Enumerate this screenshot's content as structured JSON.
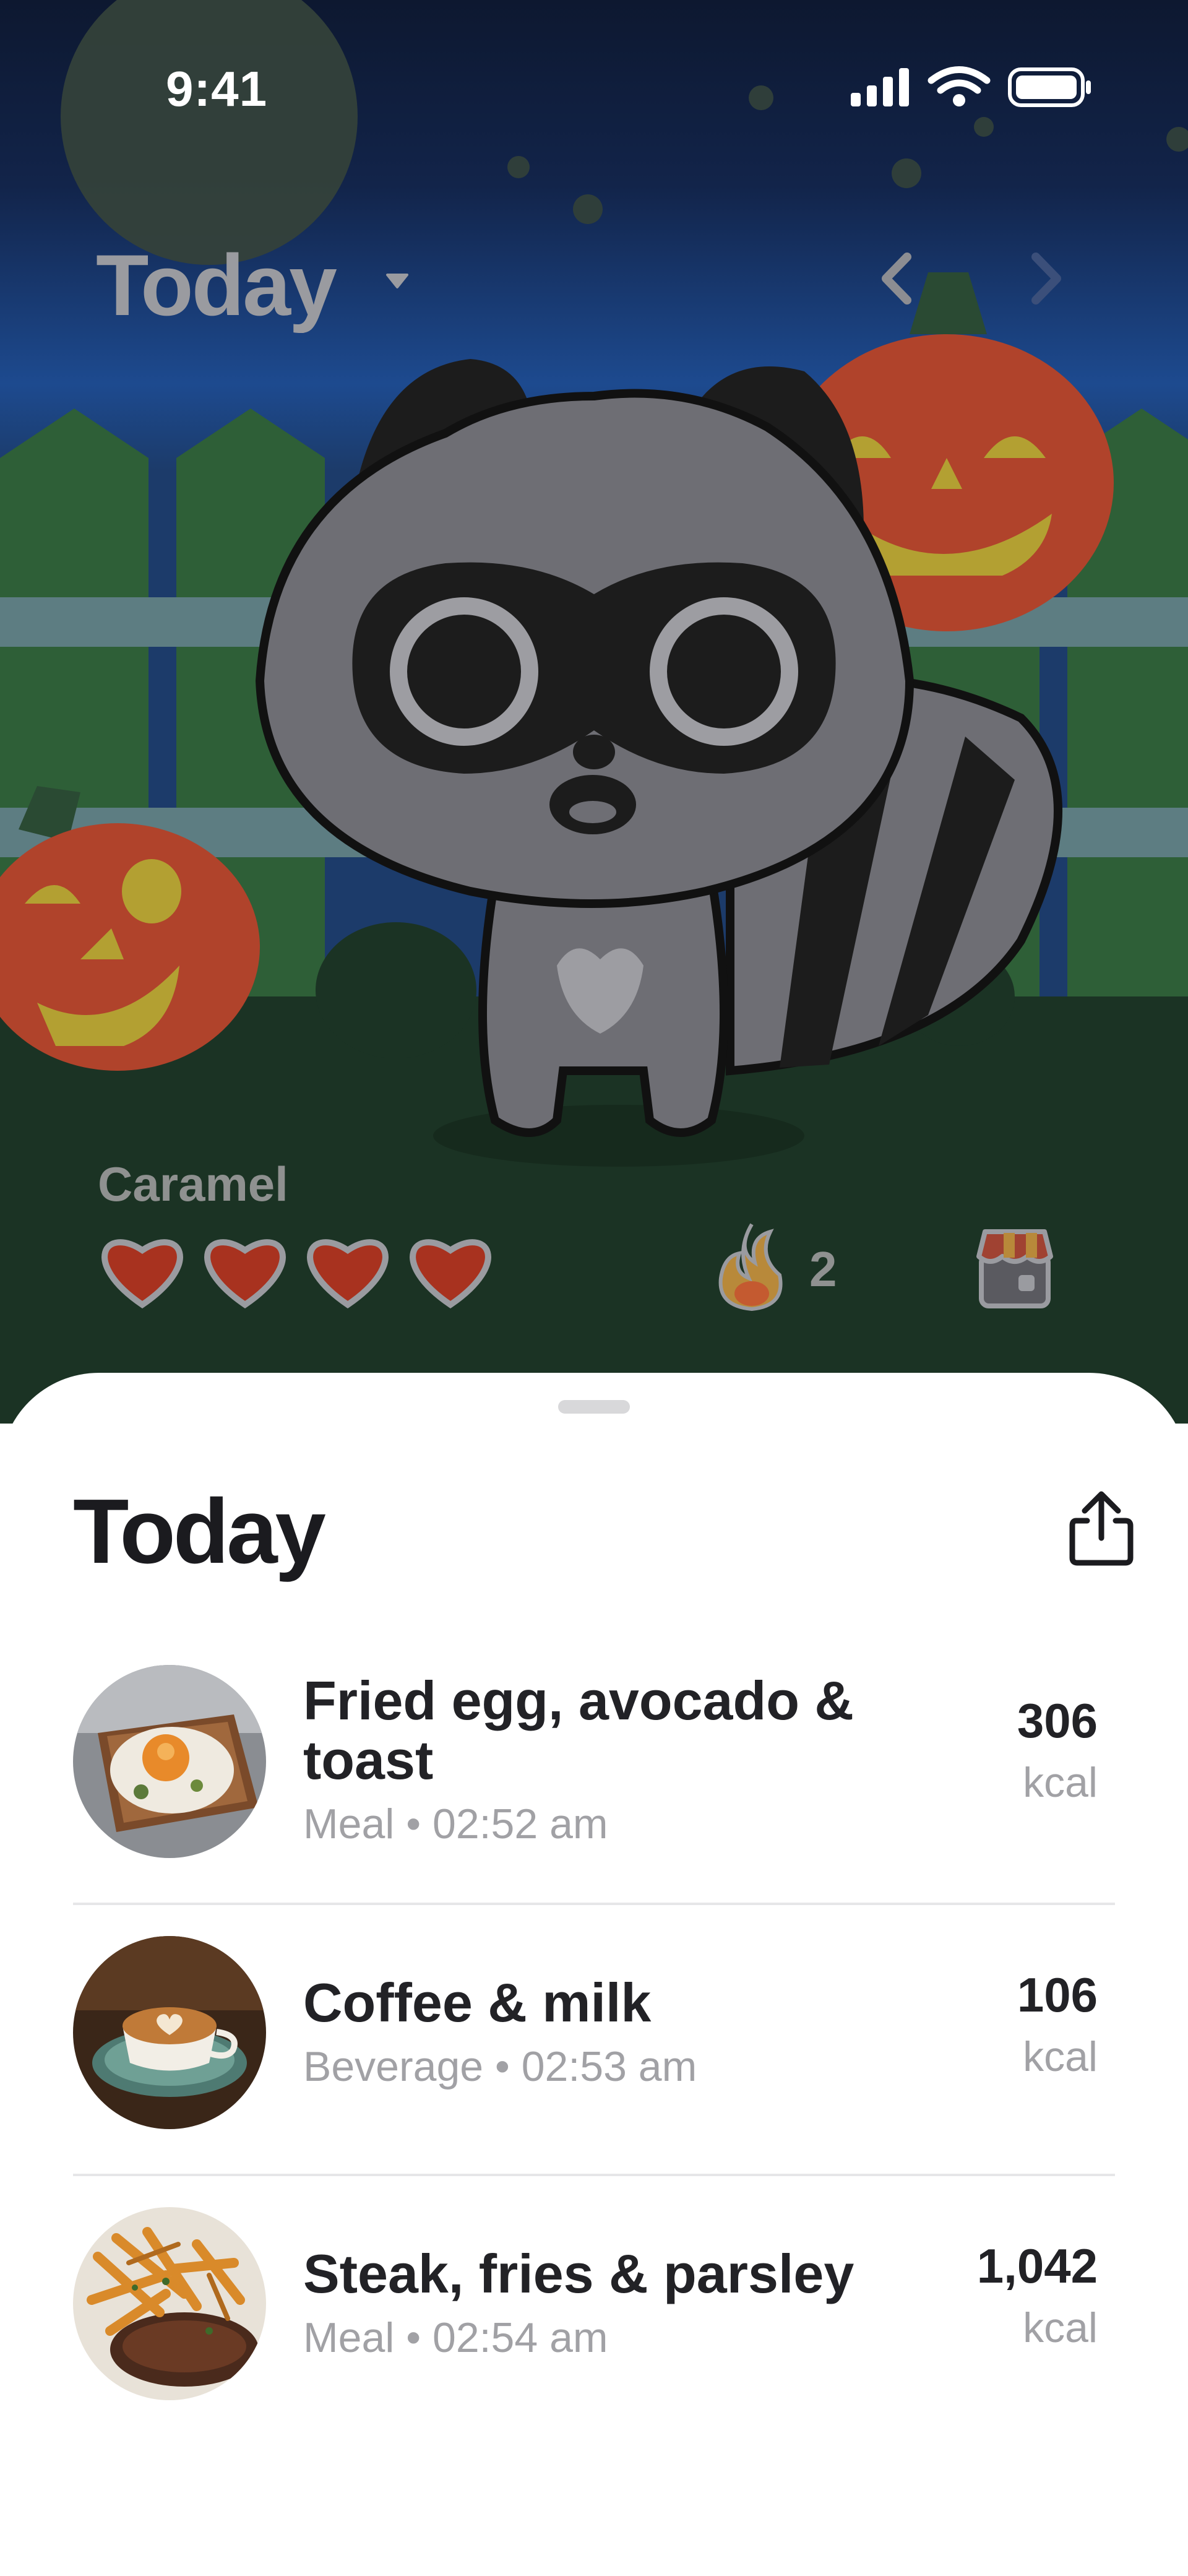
{
  "status_bar": {
    "time": "9:41"
  },
  "header": {
    "title": "Today"
  },
  "pet": {
    "name": "Caramel",
    "hearts": 4,
    "streak": "2"
  },
  "sheet": {
    "title": "Today"
  },
  "entries": [
    {
      "name": "Fried egg, avocado & toast",
      "category": "Meal",
      "time": "02:52 am",
      "kcal": "306",
      "unit": "kcal",
      "image": "fried-egg-toast-photo"
    },
    {
      "name": "Coffee & milk",
      "category": "Beverage",
      "time": "02:53 am",
      "kcal": "106",
      "unit": "kcal",
      "image": "latte-photo"
    },
    {
      "name": "Steak, fries & parsley",
      "category": "Meal",
      "time": "02:54 am",
      "kcal": "1,042",
      "unit": "kcal",
      "image": "steak-fries-photo"
    }
  ],
  "meta_separator": "•"
}
